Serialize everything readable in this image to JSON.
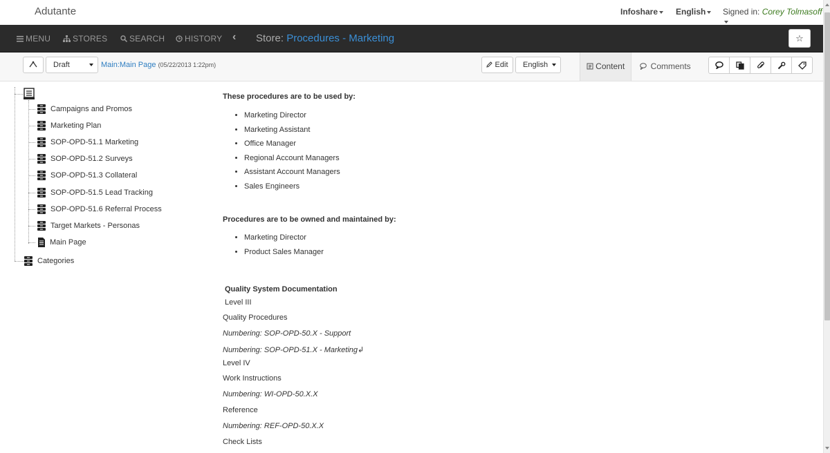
{
  "header": {
    "brand": "Adutante",
    "infoshare": "Infoshare",
    "language": "English",
    "signed_in_label": "Signed in:",
    "user": "Corey Tolmasoff"
  },
  "nav": {
    "menu": "MENU",
    "stores": "STORES",
    "search": "SEARCH",
    "history": "HISTORY",
    "back_glyph": "‹",
    "title_prefix": "Store:",
    "store_name": "Procedures - Marketing",
    "favorite_glyph": "☆"
  },
  "toolbar": {
    "status": "Draft",
    "page_link": "Main:Main Page",
    "page_date": "(05/22/2013 1:22pm)",
    "edit_label": "Edit",
    "language": "English",
    "tab_content": "Content",
    "tab_comments": "Comments",
    "icons": [
      "chat-icon",
      "copy-icon",
      "attach-icon",
      "wrench-icon",
      "tag-icon"
    ]
  },
  "tree": {
    "items": [
      "Campaigns and Promos",
      "Marketing Plan",
      "SOP-OPD-51.1 Marketing",
      "SOP-OPD-51.2 Surveys",
      "SOP-OPD-51.3 Collateral",
      "SOP-OPD-51.5 Lead Tracking",
      "SOP-OPD-51.6 Referral Process",
      "Target Markets - Personas"
    ],
    "main_page": "Main Page",
    "categories": "Categories"
  },
  "content": {
    "used_by_heading": "These procedures are to be used by:",
    "used_by": [
      "Marketing Director",
      "Marketing Assistant",
      "Office Manager",
      "Regional Account Managers",
      "Assistant Account Managers",
      "Sales Engineers"
    ],
    "owned_heading": "Procedures are to be owned and maintained by:",
    "owned_by": [
      "Marketing Director",
      "Product Sales Manager"
    ],
    "qsd_heading": "Quality System Documentation",
    "level3": "Level III",
    "quality_procedures": "Quality Procedures",
    "numbering_support": "Numbering: SOP-OPD-50.X  - Support",
    "numbering_marketing": "Numbering: SOP-OPD-51.X  - Marketing↲",
    "level4": "Level IV",
    "work_instructions": "Work Instructions",
    "numbering_wi": "Numbering: WI-OPD-50.X.X",
    "reference": "Reference",
    "numbering_ref": "Numbering: REF-OPD-50.X.X",
    "check_lists": "Check Lists"
  }
}
